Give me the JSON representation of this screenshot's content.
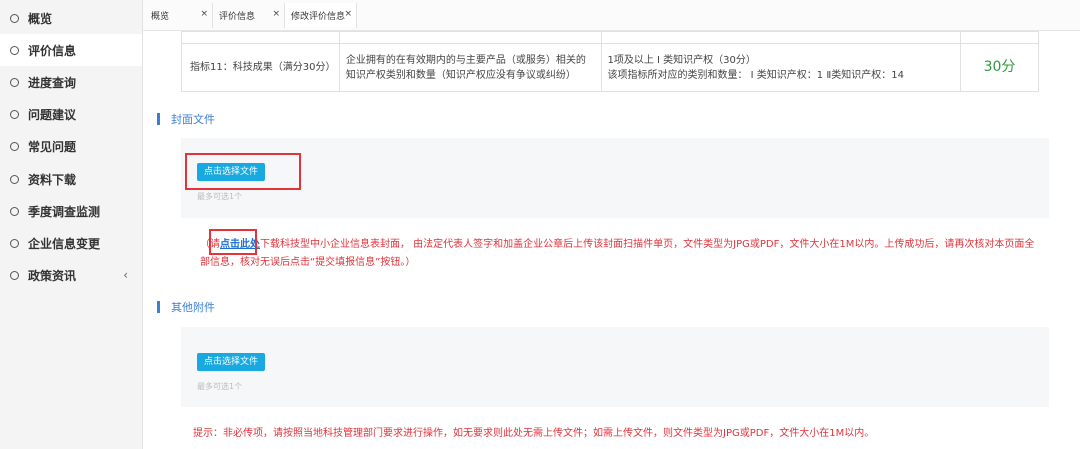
{
  "sidebar": {
    "items": [
      {
        "label": "概览"
      },
      {
        "label": "评价信息"
      },
      {
        "label": "进度查询"
      },
      {
        "label": "问题建议"
      },
      {
        "label": "常见问题"
      },
      {
        "label": "资料下载"
      },
      {
        "label": "季度调查监测"
      },
      {
        "label": "企业信息变更"
      },
      {
        "label": "政策资讯",
        "arrow": "‹"
      }
    ]
  },
  "tabs": [
    {
      "label": "概览",
      "close": "×"
    },
    {
      "label": "评价信息",
      "close": "×"
    },
    {
      "label": "修改评价信息",
      "close": "×"
    }
  ],
  "table": {
    "row": {
      "indicator": "指标11：科技成果（满分30分）",
      "description": "企业拥有的在有效期内的与主要产品（或服务）相关的知识产权类别和数量（知识产权应没有争议或纠纷）",
      "rule_line1": "1项及以上 Ⅰ 类知识产权（30分）",
      "rule_line2": "该项指标所对应的类别和数量：  Ⅰ 类知识产权：1  Ⅱ类知识产权：14",
      "score": "30分"
    }
  },
  "cover": {
    "title": "封面文件",
    "button": "点击选择文件",
    "limit": "最多可选1个",
    "note_prefix": "（请",
    "note_link": "点击此处",
    "note_line1_rest": "下载科技型中小企业信息表封面， 由法定代表人签字和加盖企业公章后上传该封面扫描件单页，文件类型为JPG或PDF，文件大小在1M以内。上传成功后，请再次核对本页面全",
    "note_line2": "部信息，核对无误后点击“提交填报信息”按钮。）"
  },
  "other": {
    "title": "其他附件",
    "button": "点击选择文件",
    "limit": "最多可选1个",
    "note": "提示：非必传项，请按照当地科技管理部门要求进行操作，如无要求则此处无需上传文件；如需上传文件，则文件类型为JPG或PDF，文件大小在1M以内。"
  },
  "colors": {
    "accent": "#3b7fd1",
    "button": "#17a9e0",
    "warning": "#e0343c",
    "score": "#2e9a3e",
    "highlight_box": "#e5333a"
  }
}
